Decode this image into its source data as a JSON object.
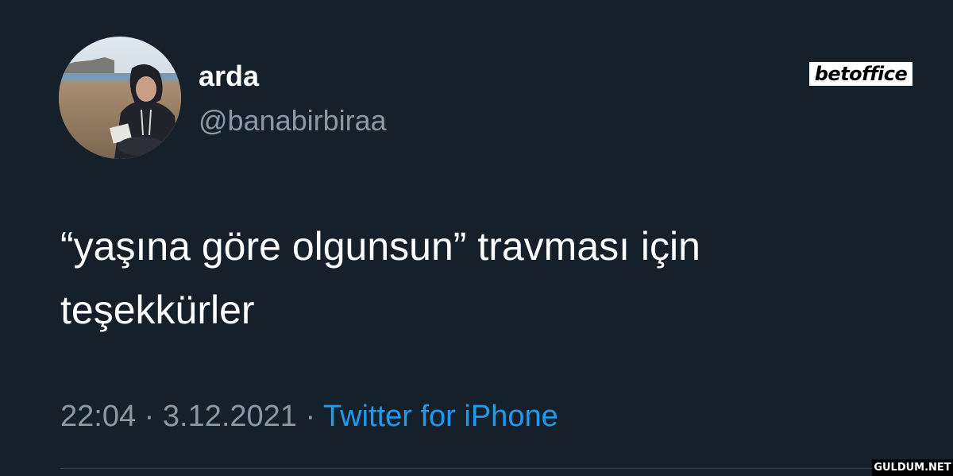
{
  "tweet": {
    "display_name": "arda",
    "handle": "@banabirbiraa",
    "text": "“yaşına göre olgunsun” travması için teşekkürler",
    "time": "22:04",
    "date": "3.12.2021",
    "separator": "·",
    "source": "Twitter for iPhone"
  },
  "overlay": {
    "brand_logo": "betoffice",
    "watermark": "GULDUM.NET"
  },
  "avatar": {
    "icon": "profile-photo"
  },
  "colors": {
    "background": "#15202b",
    "text_primary": "#ffffff",
    "text_secondary": "#8b98a5",
    "link": "#1d9bf0"
  }
}
